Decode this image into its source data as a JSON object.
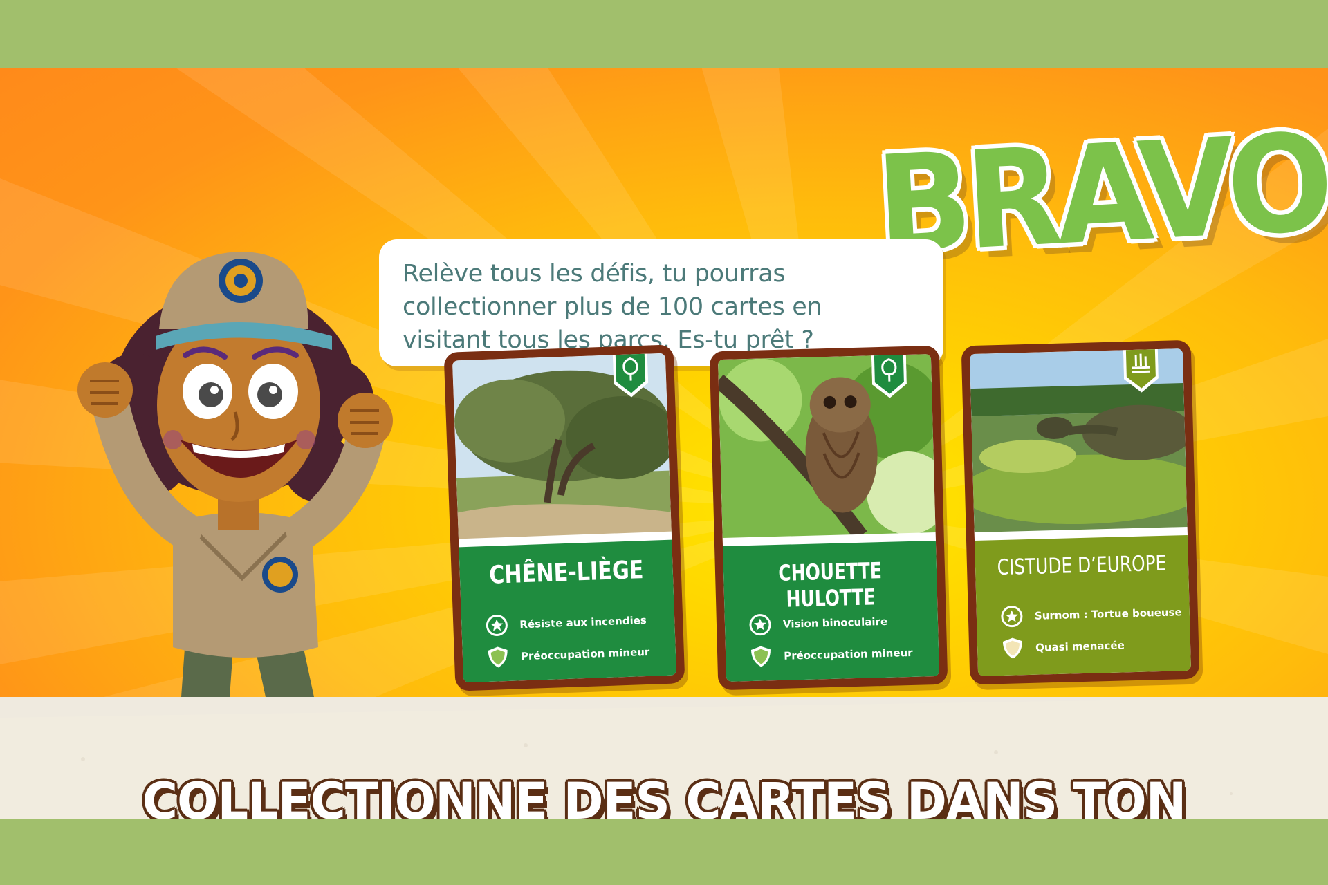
{
  "bravo_title": "BRAVO !",
  "speech_bubble": {
    "text": "Relève tous les défis, tu pourras\ncollectionner plus de 100 cartes en\nvisitant tous les parcs. Es-tu prêt ?"
  },
  "banner": "COLLECTIONNE DES CARTES DANS TON INVENTAIRE",
  "colors": {
    "card_green": "#1f8c3f",
    "card_olive": "#7f9b1c",
    "card_border": "#7a2e12",
    "bravo_green": "#7cc24a",
    "speech_text": "#4c7a79",
    "frame_green": "#a1bf6c"
  },
  "cards": [
    {
      "title": "CHÊNE-LIÈGE",
      "trait": "Résiste aux incendies",
      "status": "Préoccupation mineur",
      "trait_icon": "star-icon",
      "status_icon": "shield-icon",
      "badge_icon": "tree-badge-icon"
    },
    {
      "title": "CHOUETTE HULOTTE",
      "trait": "Vision binoculaire",
      "status": "Préoccupation mineur",
      "trait_icon": "star-icon",
      "status_icon": "shield-icon",
      "badge_icon": "tree-badge-icon"
    },
    {
      "title": "CISTUDE D’EUROPE",
      "trait": "Surnom : Tortue boueuse",
      "status": "Quasi menacée",
      "trait_icon": "star-icon",
      "status_icon": "shield-icon",
      "badge_icon": "wetland-badge-icon"
    }
  ]
}
